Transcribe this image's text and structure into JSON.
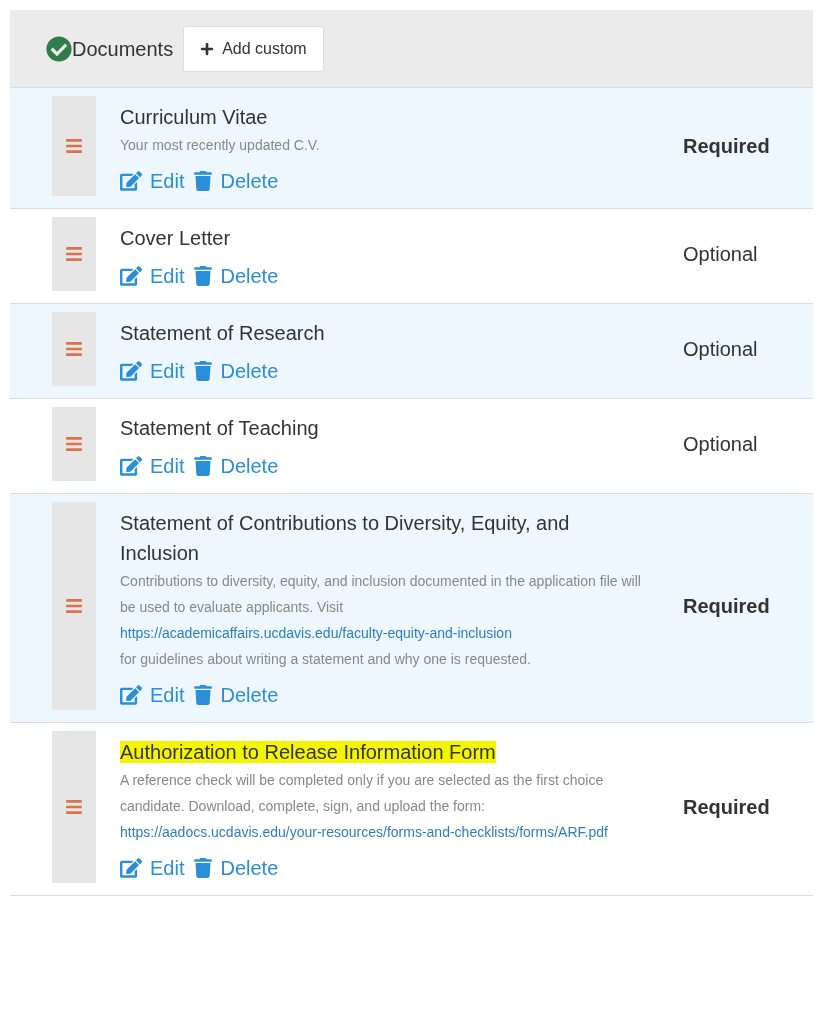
{
  "header": {
    "title": "Documents",
    "add_button": "Add custom"
  },
  "documents": [
    {
      "title": "Curriculum Vitae",
      "highlighted": false,
      "description": {
        "text": "Your most recently updated C.V."
      },
      "status": "Required",
      "required": true,
      "actions": [
        "Edit",
        "Delete"
      ]
    },
    {
      "title": "Cover Letter",
      "highlighted": false,
      "status": "Optional",
      "required": false,
      "actions": [
        "Edit",
        "Delete"
      ]
    },
    {
      "title": "Statement of Research",
      "highlighted": false,
      "status": "Optional",
      "required": false,
      "actions": [
        "Edit",
        "Delete"
      ]
    },
    {
      "title": "Statement of Teaching",
      "highlighted": false,
      "status": "Optional",
      "required": false,
      "actions": [
        "Edit",
        "Delete"
      ]
    },
    {
      "title": "Statement of Contributions to Diversity, Equity, and Inclusion",
      "highlighted": false,
      "description": {
        "text": "Contributions to diversity, equity, and inclusion documented in the application file will be used to evaluate applicants. Visit",
        "link": "https://academicaffairs.ucdavis.edu/faculty-equity-and-inclusion",
        "text_after": "for guidelines about writing a statement and why one is requested."
      },
      "status": "Required",
      "required": true,
      "actions": [
        "Edit",
        "Delete"
      ]
    },
    {
      "title": "Authorization to Release Information Form",
      "highlighted": true,
      "description": {
        "text": "A reference check will be completed only if you are selected as the first choice candidate. Download, complete, sign, and upload the form:",
        "link": "https://aadocs.ucdavis.edu/your-resources/forms-and-checklists/forms/ARF.pdf"
      },
      "status": "Required",
      "required": true,
      "actions": [
        "Edit",
        "Delete"
      ]
    }
  ]
}
